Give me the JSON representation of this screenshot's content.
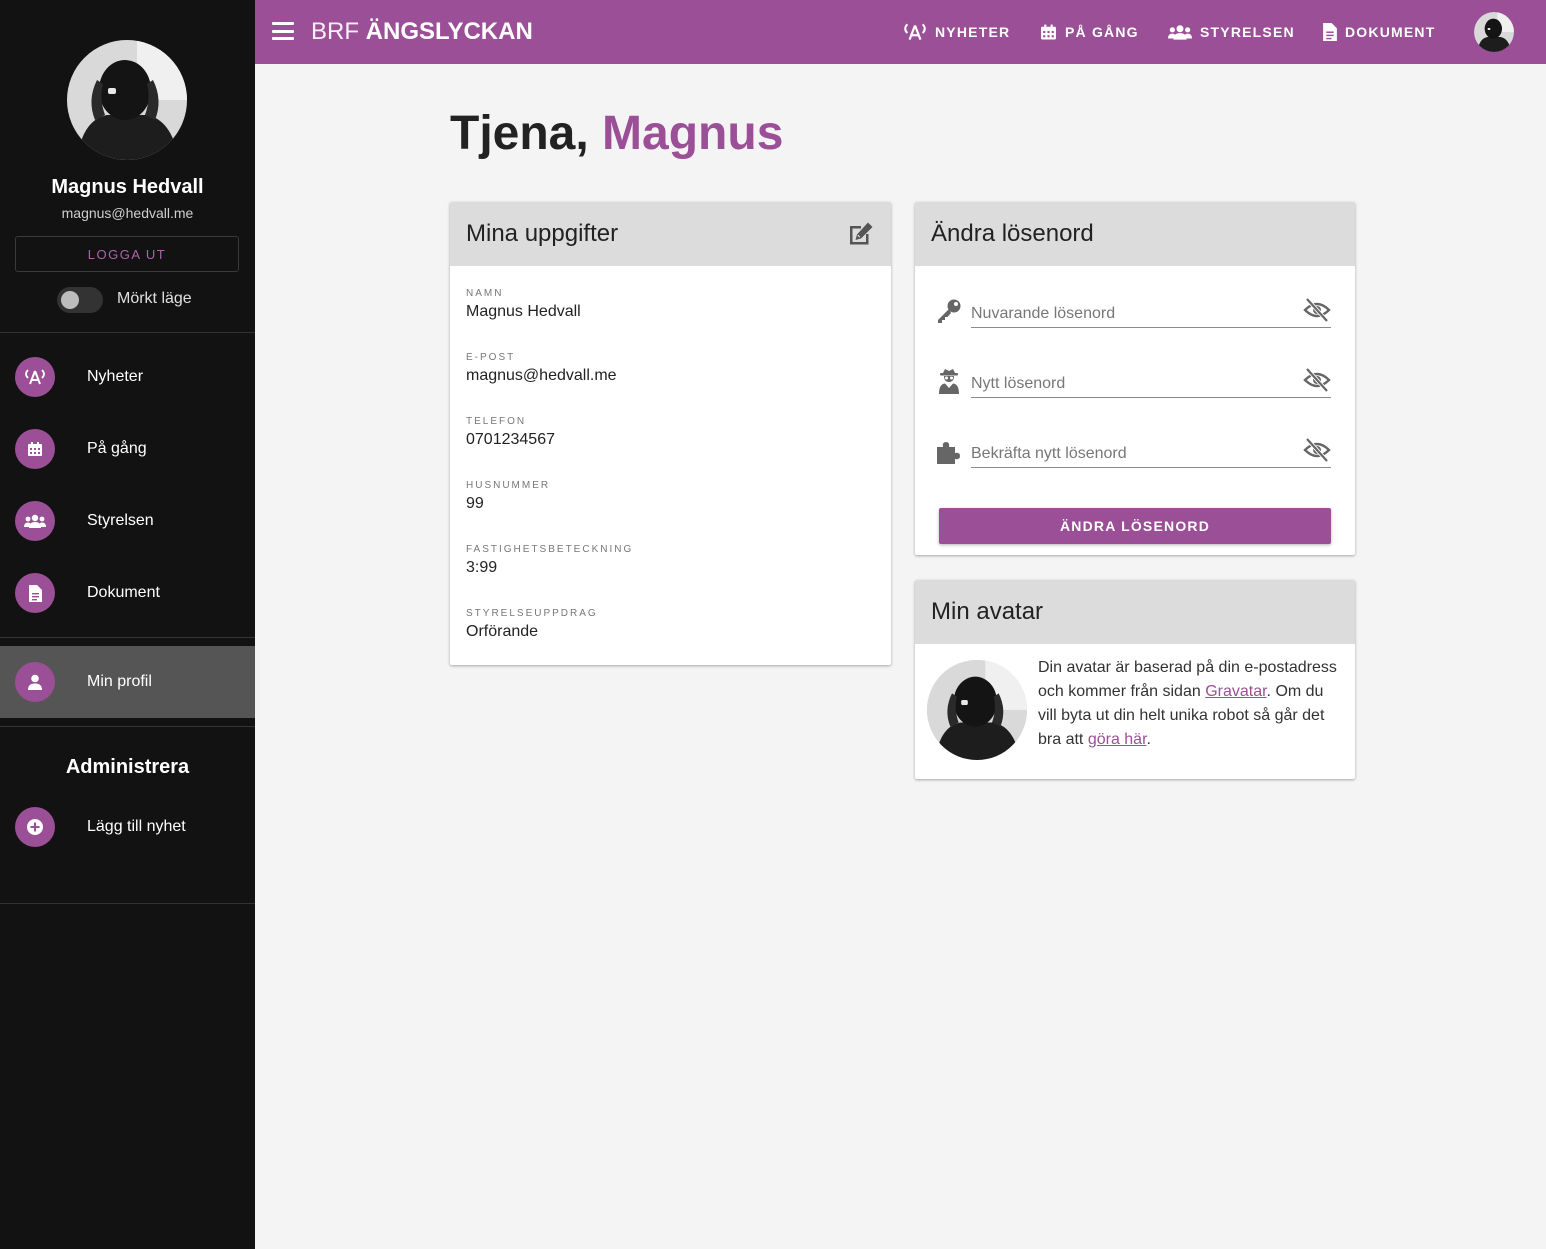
{
  "sidebar": {
    "user_name": "Magnus Hedvall",
    "user_email": "magnus@hedvall.me",
    "logout_label": "LOGGA UT",
    "dark_mode_label": "Mörkt läge",
    "dark_mode_on": false,
    "nav": [
      {
        "label": "Nyheter",
        "icon": "broadcast-icon"
      },
      {
        "label": "På gång",
        "icon": "calendar-icon"
      },
      {
        "label": "Styrelsen",
        "icon": "users-icon"
      },
      {
        "label": "Dokument",
        "icon": "document-icon"
      },
      {
        "label": "Min profil",
        "icon": "user-icon",
        "active": true
      }
    ],
    "admin_title": "Administrera",
    "admin_items": [
      {
        "label": "Lägg till nyhet",
        "icon": "plus-circle-icon"
      }
    ]
  },
  "topbar": {
    "brand_prefix": "BRF ",
    "brand_name": "ÄNGSLYCKAN",
    "nav": [
      {
        "label": "NYHETER",
        "icon": "broadcast-icon"
      },
      {
        "label": "PÅ GÅNG",
        "icon": "calendar-icon"
      },
      {
        "label": "STYRELSEN",
        "icon": "users-icon"
      },
      {
        "label": "DOKUMENT",
        "icon": "document-icon"
      }
    ]
  },
  "main": {
    "greeting_prefix": "Tjena, ",
    "greeting_name": "Magnus",
    "details_card": {
      "title": "Mina uppgifter",
      "fields": [
        {
          "label": "NAMN",
          "value": "Magnus Hedvall"
        },
        {
          "label": "E-POST",
          "value": "magnus@hedvall.me"
        },
        {
          "label": "TELEFON",
          "value": "0701234567"
        },
        {
          "label": "HUSNUMMER",
          "value": "99"
        },
        {
          "label": "FASTIGHETSBETECKNING",
          "value": "3:99"
        },
        {
          "label": "STYRELSEUPPDRAG",
          "value": "Orförande"
        }
      ]
    },
    "password_card": {
      "title": "Ändra lösenord",
      "current_placeholder": "Nuvarande lösenord",
      "new_placeholder": "Nytt lösenord",
      "confirm_placeholder": "Bekräfta nytt lösenord",
      "submit_label": "ÄNDRA LÖSENORD"
    },
    "avatar_card": {
      "title": "Min avatar",
      "text_1": "Din avatar är baserad på din e-postadress och kommer från sidan ",
      "link_1": "Gravatar",
      "text_2": ". Om du vill byta ut din helt unika robot så går det bra att ",
      "link_2": "göra här",
      "text_3": "."
    }
  },
  "colors": {
    "accent": "#9b4f96",
    "sidebar_bg": "#121212",
    "page_bg": "#f4f4f4",
    "card_header_bg": "#dcdcdc"
  }
}
